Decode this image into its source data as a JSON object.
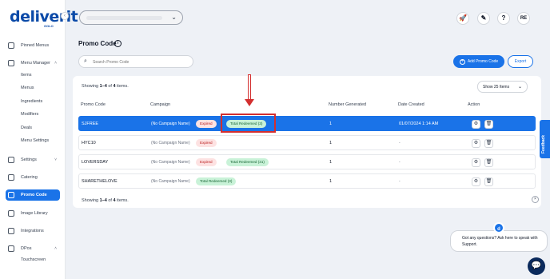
{
  "brand": {
    "name": "deliverit",
    "sub": "GOLO"
  },
  "sidebar": {
    "collapse_icon": "‹",
    "items": [
      {
        "label": "Pinned Menus",
        "icon": "pin-icon"
      },
      {
        "label": "Menu Manager",
        "icon": "menu-icon",
        "chevron": "˄"
      },
      {
        "label": "Settings",
        "icon": "gear-icon",
        "chevron": "˅"
      },
      {
        "label": "Catering",
        "icon": "catering-icon"
      },
      {
        "label": "Promo Code",
        "icon": "promo-icon",
        "active": true
      },
      {
        "label": "Image Library",
        "icon": "image-icon"
      },
      {
        "label": "Integrations",
        "icon": "integrations-icon"
      },
      {
        "label": "DPos",
        "icon": "dpos-icon",
        "chevron": "˄"
      }
    ],
    "menu_manager_sub": [
      "Items",
      "Menus",
      "Ingredients",
      "Modifiers",
      "Deals",
      "Menu Settings"
    ],
    "dpos_sub": [
      "Touchscreen"
    ]
  },
  "topbar": {
    "store_chevron": "⌄",
    "icons": [
      "rocket-icon",
      "brush-icon",
      "help-icon"
    ],
    "help_label": "?",
    "avatar": "RE"
  },
  "page": {
    "title": "Promo Code",
    "search_placeholder": "Search Promo Code",
    "add_button": "Add Promo Code",
    "export_button": "Export",
    "showing_prefix": "Showing ",
    "showing_range": "1–4",
    "showing_of": " of ",
    "showing_total": "4",
    "showing_suffix": " items.",
    "page_size": "Show 25 Items"
  },
  "table": {
    "columns": [
      "Promo Code",
      "Campaign",
      "Number Generated",
      "Date Created",
      "Action"
    ],
    "rows": [
      {
        "code": "SJFREE",
        "campaign": "(No Campaign Name)",
        "badges": [
          "Expired",
          "Total Redeemed (3)"
        ],
        "generated": "1",
        "date": "01/07/2024 1:14 AM",
        "selected": true
      },
      {
        "code": "HYC10",
        "campaign": "(No Campaign Name)",
        "badges": [
          "Expired"
        ],
        "generated": "1",
        "date": "-"
      },
      {
        "code": "LOVERSDAY",
        "campaign": "(No Campaign Name)",
        "badges": [
          "Expired",
          "Total Redeemed (31)"
        ],
        "generated": "1",
        "date": "-"
      },
      {
        "code": "SHARETHELOVE",
        "campaign": "(No Campaign Name)",
        "badges": [
          "Total Redeemed (3)"
        ],
        "generated": "1",
        "date": "-"
      }
    ]
  },
  "feedback": {
    "label": "Feedback"
  },
  "chat": {
    "close": "×",
    "message": "Got any questions? Ask here to speak with Support.",
    "avatar": "d",
    "launcher_icon": "chat-icon"
  },
  "colors": {
    "accent": "#1a73e8",
    "highlight": "#d32f2f",
    "expired_bg": "#fde2e2",
    "redeemed_bg": "#c9f2d8"
  }
}
